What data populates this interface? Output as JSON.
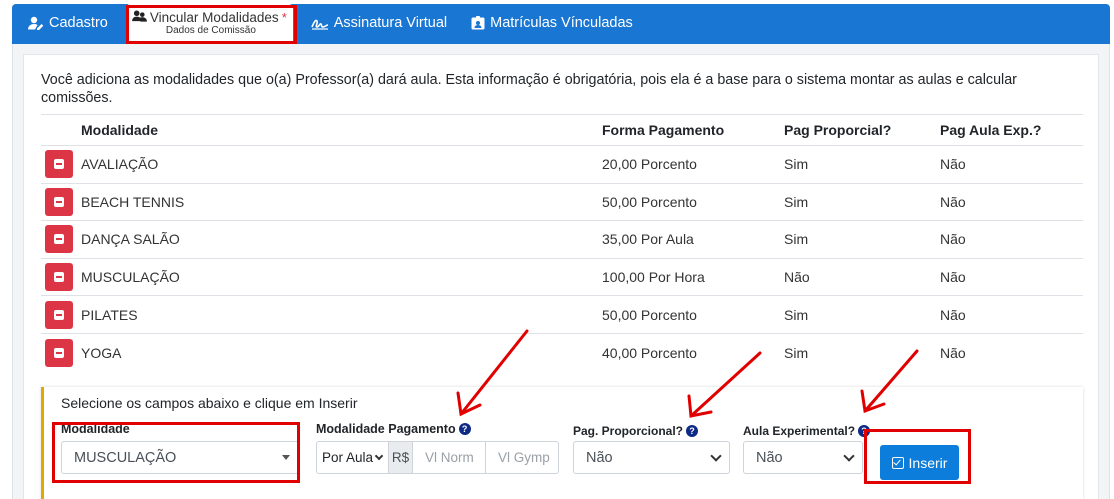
{
  "tabs": [
    {
      "label": "Cadastro",
      "icon": "user-edit-icon"
    },
    {
      "label": "Vincular Modalidades",
      "sublabel": "Dados de Comissão",
      "icon": "users-icon",
      "required_mark": "*",
      "active": true
    },
    {
      "label": "Assinatura Virtual",
      "icon": "signature-icon"
    },
    {
      "label": "Matrículas Vínculadas",
      "icon": "id-badge-icon"
    }
  ],
  "intro": "Você adiciona as modalidades que o(a) Professor(a) dará aula. Esta informação é obrigatória, pois ela é a base para o sistema montar as aulas e calcular comissões.",
  "table": {
    "headers": [
      "Modalidade",
      "Forma Pagamento",
      "Pag Proporcial?",
      "Pag Aula Exp.?"
    ],
    "rows": [
      [
        "AVALIAÇÃO",
        "20,00 Porcento",
        "Sim",
        "Não"
      ],
      [
        "BEACH TENNIS",
        "50,00 Porcento",
        "Sim",
        "Não"
      ],
      [
        "DANÇA SALÃO",
        "35,00 Por Aula",
        "Sim",
        "Não"
      ],
      [
        "MUSCULAÇÃO",
        "100,00 Por Hora",
        "Não",
        "Não"
      ],
      [
        "PILATES",
        "50,00 Porcento",
        "Sim",
        "Não"
      ],
      [
        "YOGA",
        "40,00 Porcento",
        "Sim",
        "Não"
      ]
    ]
  },
  "insert": {
    "title": "Selecione os campos abaixo e clique em Inserir",
    "modalidade_label": "Modalidade",
    "modalidade_value": "MUSCULAÇÃO",
    "pagamento_label": "Modalidade Pagamento",
    "pagamento_type": "Por Aula",
    "currency": "R$",
    "placeholder_1": "Vl Norm",
    "placeholder_2": "Vl Gymp",
    "proporcional_label": "Pag. Proporcional?",
    "proporcional_value": "Não",
    "experimental_label": "Aula Experimental?",
    "experimental_value": "Não",
    "insert_button": "Inserir",
    "help_icon": "?"
  },
  "colors": {
    "tabbar": "#1976d2",
    "danger": "#dc3545",
    "primary": "#0d7ddb",
    "highlight": "#e00000",
    "accent_border": "#e0a800"
  }
}
